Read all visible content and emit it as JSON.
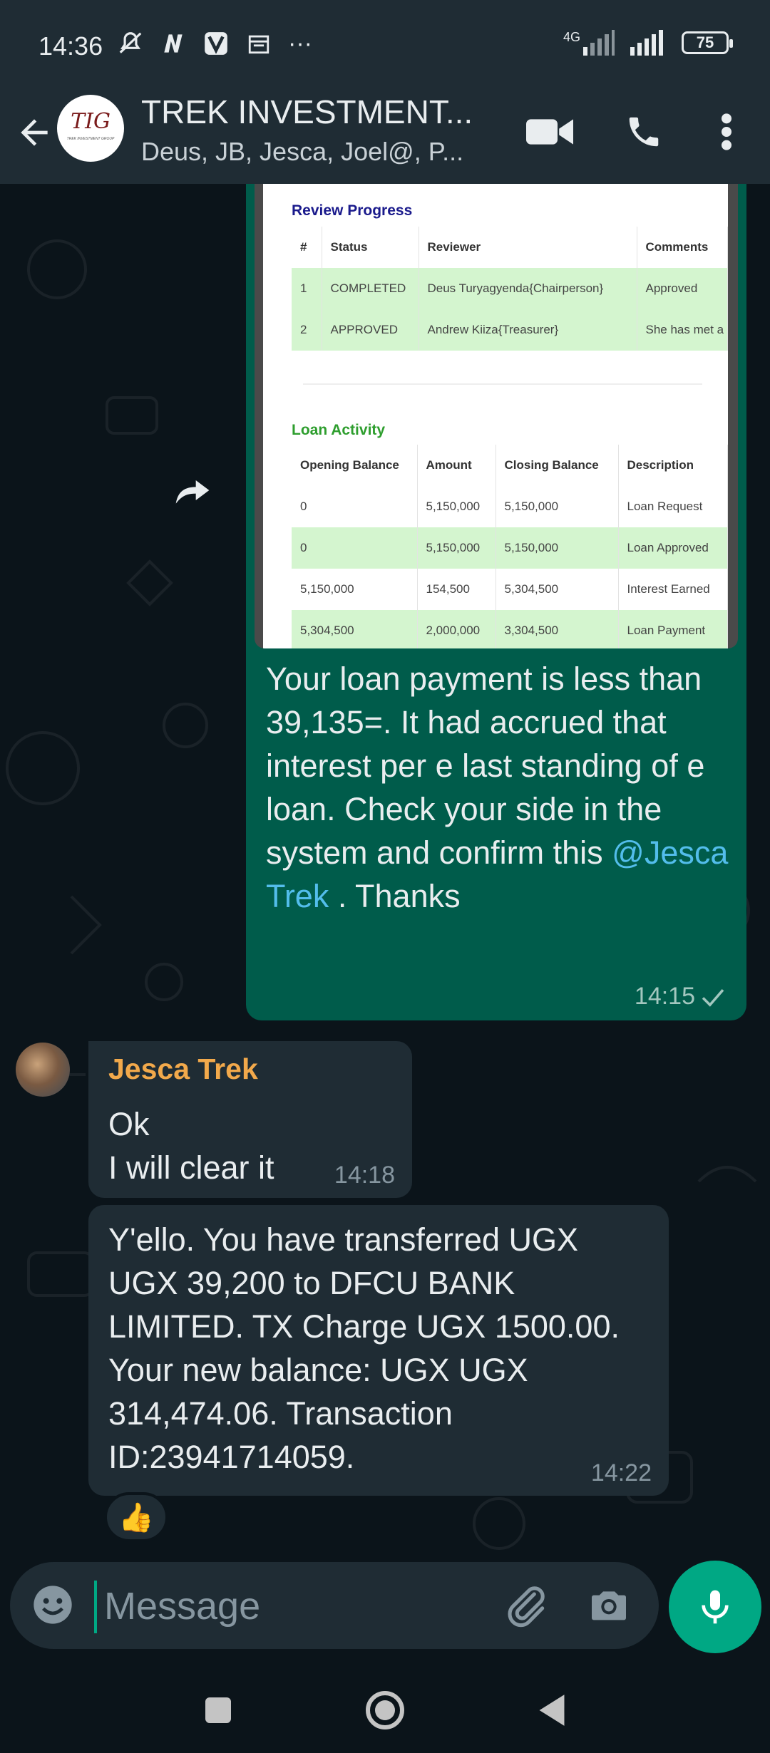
{
  "status_bar": {
    "time": "14:36",
    "network": "4G",
    "battery": "75",
    "overflow": "···"
  },
  "header": {
    "title": "TREK INVESTMENT...",
    "members": "Deus, JB, Jesca, Joel@, P...",
    "avatar_initials": "TIG",
    "avatar_caption": "TREK INVESTMENT GROUP"
  },
  "image_doc": {
    "review_heading": "Review Progress",
    "review_columns": [
      "#",
      "Status",
      "Reviewer",
      "Comments"
    ],
    "review_rows": [
      [
        "1",
        "COMPLETED",
        "Deus Turyagyenda{Chairperson}",
        "Approved"
      ],
      [
        "2",
        "APPROVED",
        "Andrew Kiiza{Treasurer}",
        "She has met a"
      ]
    ],
    "activity_heading": "Loan Activity",
    "activity_columns": [
      "Opening Balance",
      "Amount",
      "Closing Balance",
      "Description"
    ],
    "activity_rows": [
      [
        "0",
        "5,150,000",
        "5,150,000",
        "Loan Request"
      ],
      [
        "0",
        "5,150,000",
        "5,150,000",
        "Loan Approved"
      ],
      [
        "5,150,000",
        "154,500",
        "5,304,500",
        "Interest Earned"
      ],
      [
        "5,304,500",
        "2,000,000",
        "3,304,500",
        "Loan Payment"
      ]
    ]
  },
  "messages": {
    "outgoing": {
      "text": "Your loan payment is less than 39,135=.  It had accrued that interest per e last standing of e loan. Check your side in the system and confirm this ",
      "mention": "@Jesca Trek",
      "tail": " . Thanks",
      "time": "14:15"
    },
    "incoming1": {
      "sender": "Jesca Trek",
      "line1": "Ok",
      "line2": "I will clear it",
      "time": "14:18"
    },
    "incoming2": {
      "text": "Y'ello. You have transferred UGX UGX 39,200 to DFCU BANK LIMITED. TX Charge  UGX 1500.00. Your new balance: UGX UGX 314,474.06. Transaction ID:23941714059.",
      "time": "14:22",
      "reaction": "👍"
    }
  },
  "input": {
    "placeholder": "Message"
  },
  "colors": {
    "header_bg": "#1f2c34",
    "chat_bg": "#0b141a",
    "outgoing_bubble": "#005c4b",
    "incoming_bubble": "#1f2c34",
    "accent": "#00a884",
    "mention": "#53bdeb",
    "sender_name": "#f2a94b"
  }
}
